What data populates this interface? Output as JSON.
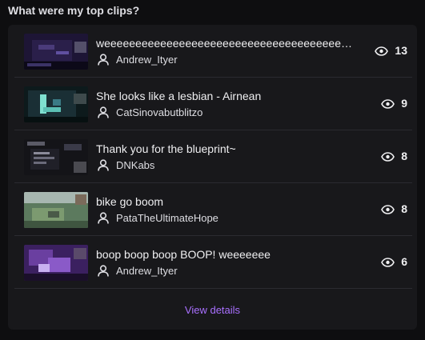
{
  "heading": "What were my top clips?",
  "clips": [
    {
      "title": "weeeeeeeeeeeeeeeeeeeeeeeeeeeeeeeeeeeeeeeeeeeeeeeeeeeeeeeeeeeeeeeeeeeeeeeee",
      "author": "Andrew_Ityer",
      "views": "13"
    },
    {
      "title": "She looks like a lesbian - Airnean",
      "author": "CatSinovabutblitzo",
      "views": "9"
    },
    {
      "title": "Thank you for the blueprint~",
      "author": "DNKabs",
      "views": "8"
    },
    {
      "title": "bike go boom",
      "author": "PataTheUltimateHope",
      "views": "8"
    },
    {
      "title": "boop boop boop BOOP! weeeeeee",
      "author": "Andrew_Ityer",
      "views": "6"
    }
  ],
  "footer": {
    "link_label": "View details"
  },
  "colors": {
    "accent": "#a970ff",
    "background": "#0e0e10",
    "card": "#18181b"
  },
  "icons": {
    "author": "user-icon",
    "views": "eye-icon"
  }
}
